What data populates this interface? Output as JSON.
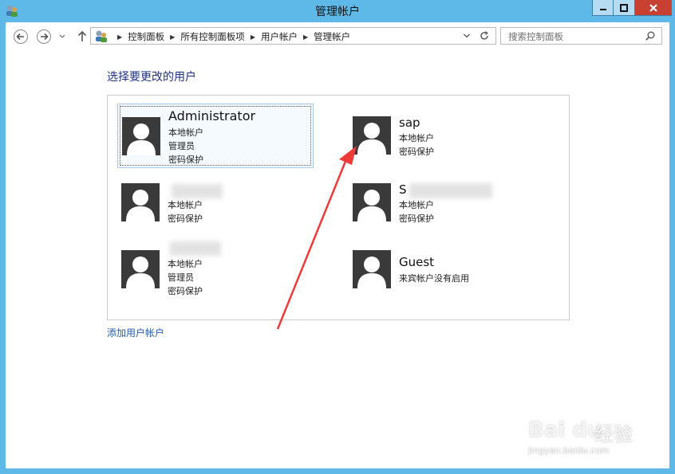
{
  "window": {
    "title": "管理帐户",
    "accent": "#5fb9e8",
    "close_color": "#c74031"
  },
  "navigation": {
    "back_icon": "back-arrow-icon",
    "forward_icon": "forward-arrow-icon",
    "up_icon": "up-arrow-icon",
    "breadcrumbs": [
      "控制面板",
      "所有控制面板项",
      "用户帐户",
      "管理帐户"
    ],
    "search_placeholder": "搜索控制面板"
  },
  "main": {
    "heading": "选择要更改的用户",
    "heading_color": "#1e3287",
    "add_user_link": "添加用户帐户",
    "accounts": [
      {
        "name": "Administrator",
        "lines": [
          "本地帐户",
          "管理员",
          "密码保护"
        ],
        "selected": true
      },
      {
        "name": "sap",
        "lines": [
          "本地帐户",
          "密码保护"
        ],
        "selected": false
      },
      {
        "name": "",
        "lines": [
          "本地帐户",
          "密码保护"
        ],
        "selected": false,
        "name_obscured": true
      },
      {
        "name": "S",
        "lines": [
          "本地帐户",
          "密码保护"
        ],
        "selected": false,
        "name_obscured": true
      },
      {
        "name": "",
        "lines": [
          "本地帐户",
          "管理员",
          "密码保护"
        ],
        "selected": false,
        "name_obscured": true
      },
      {
        "name": "Guest",
        "lines": [
          "来宾帐户没有启用"
        ],
        "selected": false
      }
    ]
  },
  "annotation": {
    "arrow_color": "#f03a3a"
  },
  "watermark": {
    "brand": "Bai du",
    "brand_cn": "经验",
    "url": "jingyan.baidu.com"
  }
}
